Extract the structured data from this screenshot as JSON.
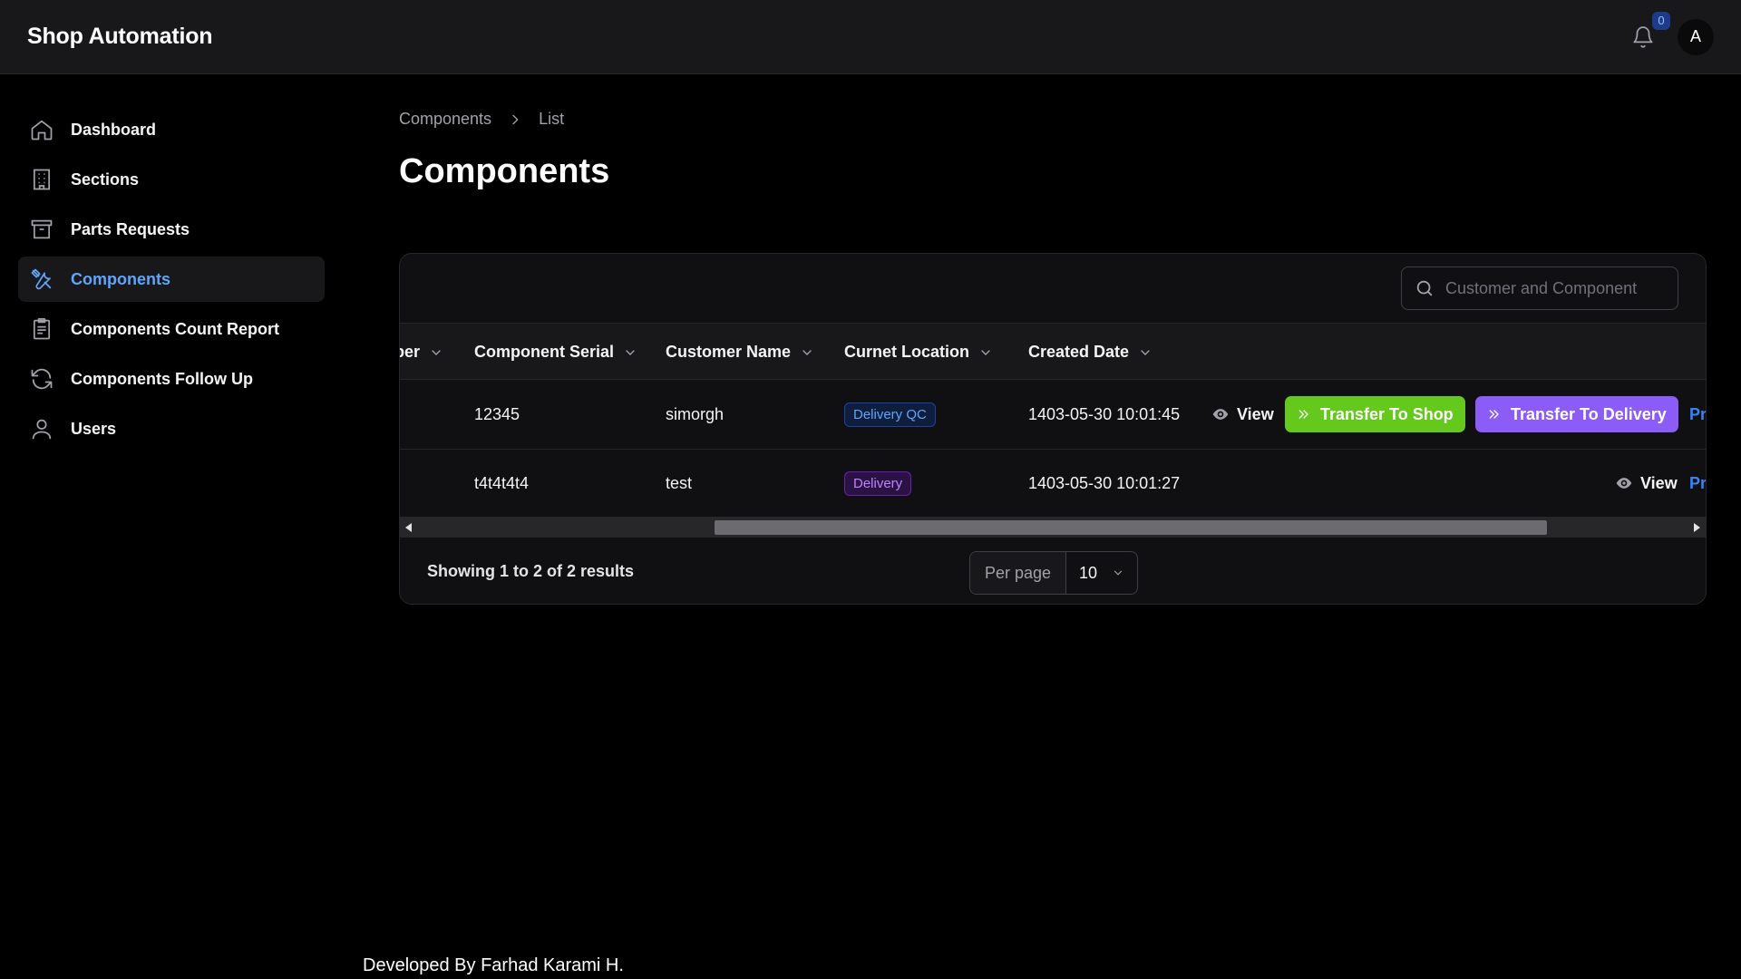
{
  "header": {
    "brand": "Shop Automation",
    "notification_count": "0",
    "avatar_initial": "A"
  },
  "sidebar": {
    "items": [
      {
        "label": "Dashboard",
        "icon": "home-icon"
      },
      {
        "label": "Sections",
        "icon": "building-icon"
      },
      {
        "label": "Parts Requests",
        "icon": "archive-box-icon"
      },
      {
        "label": "Components",
        "icon": "tools-icon",
        "active": true
      },
      {
        "label": "Components Count Report",
        "icon": "clipboard-icon"
      },
      {
        "label": "Components Follow Up",
        "icon": "refresh-icon"
      },
      {
        "label": "Users",
        "icon": "user-icon"
      }
    ]
  },
  "breadcrumb": {
    "root": "Components",
    "current": "List"
  },
  "page": {
    "title": "Components"
  },
  "table": {
    "search_placeholder": "Customer and Component",
    "columns": [
      "ber",
      "Component Serial",
      "Customer Name",
      "Curnet Location",
      "Created Date"
    ],
    "rows": [
      {
        "serial": "12345",
        "customer": "simorgh",
        "location": "Delivery QC",
        "created": "1403-05-30 10:01:45",
        "view": "View",
        "transfer_shop": "Transfer To Shop",
        "transfer_delivery": "Transfer To Delivery",
        "extra": "Pr"
      },
      {
        "serial": "t4t4t4t4",
        "customer": "test",
        "location": "Delivery",
        "created": "1403-05-30 10:01:27",
        "view": "View",
        "extra": "Pr"
      }
    ],
    "results_text": "Showing 1 to 2 of 2 results",
    "per_page_label": "Per page",
    "per_page_value": "10"
  },
  "footer": {
    "credit": "Developed By Farhad Karami H."
  },
  "colors": {
    "accent_blue": "#60a5fa",
    "green_button": "#65c81c",
    "purple_button": "#8b5cf6"
  }
}
